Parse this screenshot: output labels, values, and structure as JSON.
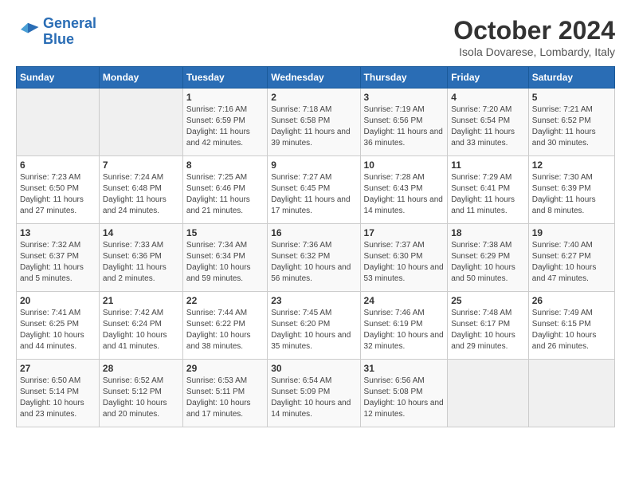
{
  "logo": {
    "line1": "General",
    "line2": "Blue"
  },
  "title": "October 2024",
  "subtitle": "Isola Dovarese, Lombardy, Italy",
  "days_of_week": [
    "Sunday",
    "Monday",
    "Tuesday",
    "Wednesday",
    "Thursday",
    "Friday",
    "Saturday"
  ],
  "weeks": [
    [
      {
        "day": "",
        "info": ""
      },
      {
        "day": "",
        "info": ""
      },
      {
        "day": "1",
        "info": "Sunrise: 7:16 AM\nSunset: 6:59 PM\nDaylight: 11 hours and 42 minutes."
      },
      {
        "day": "2",
        "info": "Sunrise: 7:18 AM\nSunset: 6:58 PM\nDaylight: 11 hours and 39 minutes."
      },
      {
        "day": "3",
        "info": "Sunrise: 7:19 AM\nSunset: 6:56 PM\nDaylight: 11 hours and 36 minutes."
      },
      {
        "day": "4",
        "info": "Sunrise: 7:20 AM\nSunset: 6:54 PM\nDaylight: 11 hours and 33 minutes."
      },
      {
        "day": "5",
        "info": "Sunrise: 7:21 AM\nSunset: 6:52 PM\nDaylight: 11 hours and 30 minutes."
      }
    ],
    [
      {
        "day": "6",
        "info": "Sunrise: 7:23 AM\nSunset: 6:50 PM\nDaylight: 11 hours and 27 minutes."
      },
      {
        "day": "7",
        "info": "Sunrise: 7:24 AM\nSunset: 6:48 PM\nDaylight: 11 hours and 24 minutes."
      },
      {
        "day": "8",
        "info": "Sunrise: 7:25 AM\nSunset: 6:46 PM\nDaylight: 11 hours and 21 minutes."
      },
      {
        "day": "9",
        "info": "Sunrise: 7:27 AM\nSunset: 6:45 PM\nDaylight: 11 hours and 17 minutes."
      },
      {
        "day": "10",
        "info": "Sunrise: 7:28 AM\nSunset: 6:43 PM\nDaylight: 11 hours and 14 minutes."
      },
      {
        "day": "11",
        "info": "Sunrise: 7:29 AM\nSunset: 6:41 PM\nDaylight: 11 hours and 11 minutes."
      },
      {
        "day": "12",
        "info": "Sunrise: 7:30 AM\nSunset: 6:39 PM\nDaylight: 11 hours and 8 minutes."
      }
    ],
    [
      {
        "day": "13",
        "info": "Sunrise: 7:32 AM\nSunset: 6:37 PM\nDaylight: 11 hours and 5 minutes."
      },
      {
        "day": "14",
        "info": "Sunrise: 7:33 AM\nSunset: 6:36 PM\nDaylight: 11 hours and 2 minutes."
      },
      {
        "day": "15",
        "info": "Sunrise: 7:34 AM\nSunset: 6:34 PM\nDaylight: 10 hours and 59 minutes."
      },
      {
        "day": "16",
        "info": "Sunrise: 7:36 AM\nSunset: 6:32 PM\nDaylight: 10 hours and 56 minutes."
      },
      {
        "day": "17",
        "info": "Sunrise: 7:37 AM\nSunset: 6:30 PM\nDaylight: 10 hours and 53 minutes."
      },
      {
        "day": "18",
        "info": "Sunrise: 7:38 AM\nSunset: 6:29 PM\nDaylight: 10 hours and 50 minutes."
      },
      {
        "day": "19",
        "info": "Sunrise: 7:40 AM\nSunset: 6:27 PM\nDaylight: 10 hours and 47 minutes."
      }
    ],
    [
      {
        "day": "20",
        "info": "Sunrise: 7:41 AM\nSunset: 6:25 PM\nDaylight: 10 hours and 44 minutes."
      },
      {
        "day": "21",
        "info": "Sunrise: 7:42 AM\nSunset: 6:24 PM\nDaylight: 10 hours and 41 minutes."
      },
      {
        "day": "22",
        "info": "Sunrise: 7:44 AM\nSunset: 6:22 PM\nDaylight: 10 hours and 38 minutes."
      },
      {
        "day": "23",
        "info": "Sunrise: 7:45 AM\nSunset: 6:20 PM\nDaylight: 10 hours and 35 minutes."
      },
      {
        "day": "24",
        "info": "Sunrise: 7:46 AM\nSunset: 6:19 PM\nDaylight: 10 hours and 32 minutes."
      },
      {
        "day": "25",
        "info": "Sunrise: 7:48 AM\nSunset: 6:17 PM\nDaylight: 10 hours and 29 minutes."
      },
      {
        "day": "26",
        "info": "Sunrise: 7:49 AM\nSunset: 6:15 PM\nDaylight: 10 hours and 26 minutes."
      }
    ],
    [
      {
        "day": "27",
        "info": "Sunrise: 6:50 AM\nSunset: 5:14 PM\nDaylight: 10 hours and 23 minutes."
      },
      {
        "day": "28",
        "info": "Sunrise: 6:52 AM\nSunset: 5:12 PM\nDaylight: 10 hours and 20 minutes."
      },
      {
        "day": "29",
        "info": "Sunrise: 6:53 AM\nSunset: 5:11 PM\nDaylight: 10 hours and 17 minutes."
      },
      {
        "day": "30",
        "info": "Sunrise: 6:54 AM\nSunset: 5:09 PM\nDaylight: 10 hours and 14 minutes."
      },
      {
        "day": "31",
        "info": "Sunrise: 6:56 AM\nSunset: 5:08 PM\nDaylight: 10 hours and 12 minutes."
      },
      {
        "day": "",
        "info": ""
      },
      {
        "day": "",
        "info": ""
      }
    ]
  ]
}
